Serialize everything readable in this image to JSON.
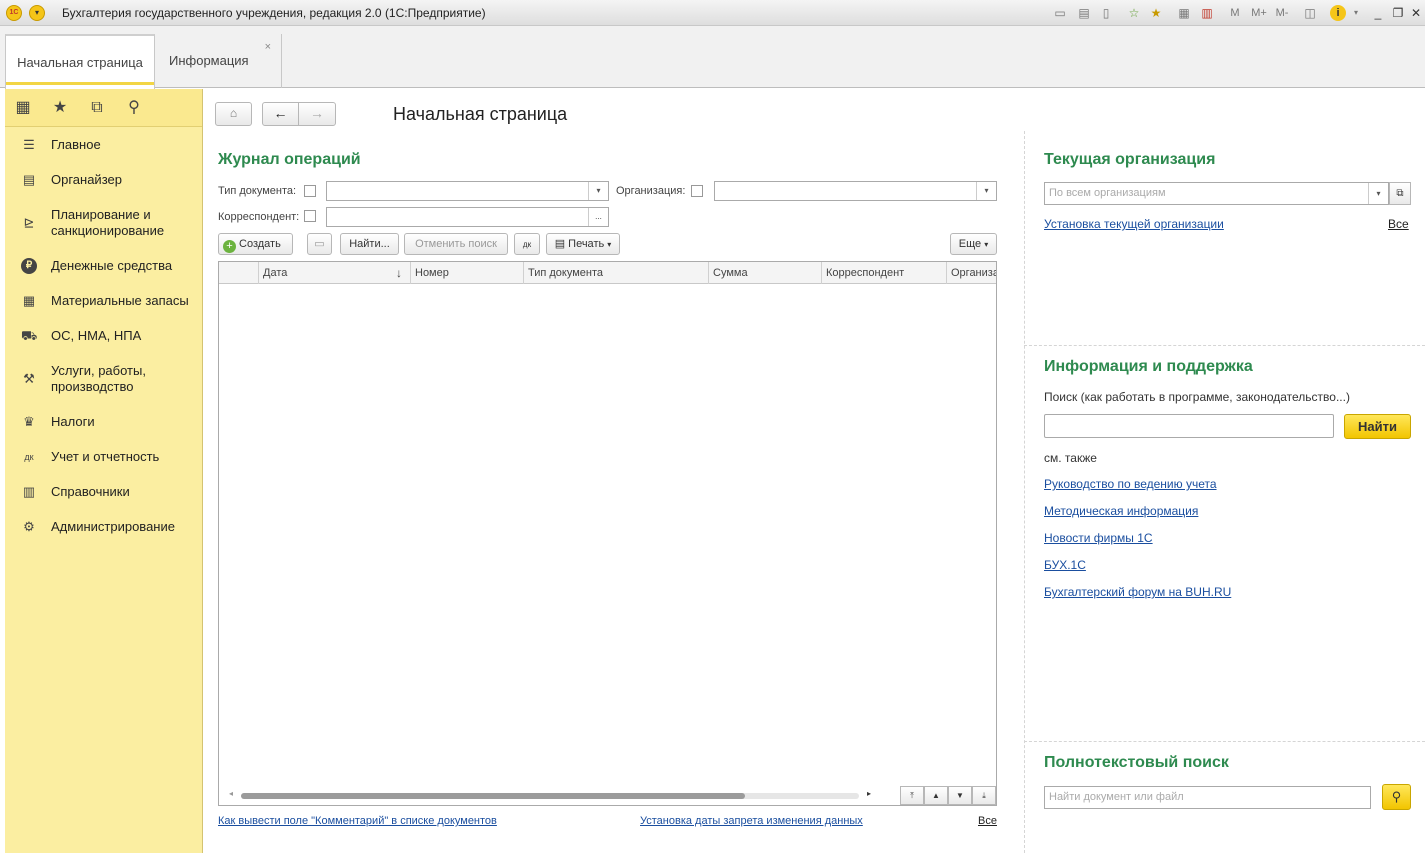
{
  "window": {
    "title": "Бухгалтерия государственного учреждения, редакция 2.0  (1С:Предприятие)"
  },
  "tabs": [
    {
      "label": "Начальная страница",
      "active": true
    },
    {
      "label": "Информация",
      "active": false,
      "close": "×"
    }
  ],
  "sidebar": {
    "items": [
      {
        "label": "Главное",
        "icon": "menu-lines-icon"
      },
      {
        "label": "Органайзер",
        "icon": "notebook-icon"
      },
      {
        "label": "Планирование и санкционирование",
        "icon": "planning-icon"
      },
      {
        "label": "Денежные средства",
        "icon": "ruble-icon"
      },
      {
        "label": "Материальные запасы",
        "icon": "warehouse-icon"
      },
      {
        "label": "ОС, НМА, НПА",
        "icon": "truck-icon"
      },
      {
        "label": "Услуги, работы, производство",
        "icon": "tools-icon"
      },
      {
        "label": "Налоги",
        "icon": "emblem-icon"
      },
      {
        "label": "Учет и отчетность",
        "icon": "dt-kt-icon"
      },
      {
        "label": "Справочники",
        "icon": "books-icon"
      },
      {
        "label": "Администрирование",
        "icon": "gear-icon"
      }
    ]
  },
  "page": {
    "title": "Начальная страница"
  },
  "journal": {
    "title": "Журнал операций",
    "doc_type_label": "Тип документа:",
    "org_label": "Организация:",
    "correspondent_label": "Корреспондент:",
    "browse": "...",
    "toolbar": {
      "create": "Создать",
      "find": "Найти...",
      "cancel_search": "Отменить поиск",
      "print": "Печать",
      "more": "Еще"
    },
    "columns": [
      "Дата",
      "Номер",
      "Тип документа",
      "Сумма",
      "Корреспондент",
      "Организация"
    ],
    "sort_arrow": "↓",
    "footer_links": [
      "Как вывести поле \"Комментарий\" в списке документов",
      "Установка даты запрета изменения данных",
      "Все"
    ]
  },
  "org_panel": {
    "title": "Текущая организация",
    "placeholder": "По всем организациям",
    "link": "Установка текущей организации",
    "all": "Все"
  },
  "info_panel": {
    "title": "Информация и поддержка",
    "search_hint": "Поиск (как работать в программе, законодательство...)",
    "find_button": "Найти",
    "see_also": "см. также",
    "links": [
      "Руководство по ведению учета",
      "Методическая информация",
      "Новости фирмы 1С",
      "БУХ.1С",
      "Бухгалтерский форум на BUH.RU"
    ]
  },
  "fulltext": {
    "title": "Полнотекстовый поиск",
    "placeholder": "Найти документ или файл"
  }
}
